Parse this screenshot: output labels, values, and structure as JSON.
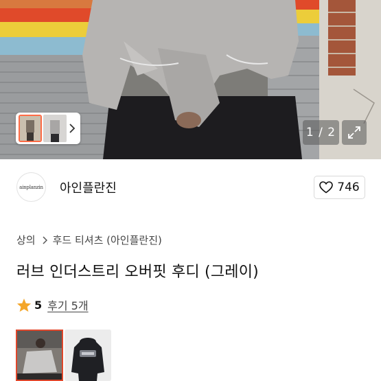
{
  "gallery": {
    "pager_current": "1",
    "pager_total": "2",
    "pager_text": "1 / 2"
  },
  "store": {
    "logo_text": "ainplanzin",
    "name": "아인플란진",
    "like_count": "746"
  },
  "breadcrumb": {
    "category": "상의",
    "subcategory": "후드 티셔츠 (아인플란진)"
  },
  "product": {
    "title": "러브 인더스트리 오버핏 후디 (그레이)"
  },
  "rating": {
    "score": "5",
    "review_label": "후기 5개"
  },
  "colors": {
    "star": "#f4a62a",
    "selected_border": "#e0472b"
  }
}
